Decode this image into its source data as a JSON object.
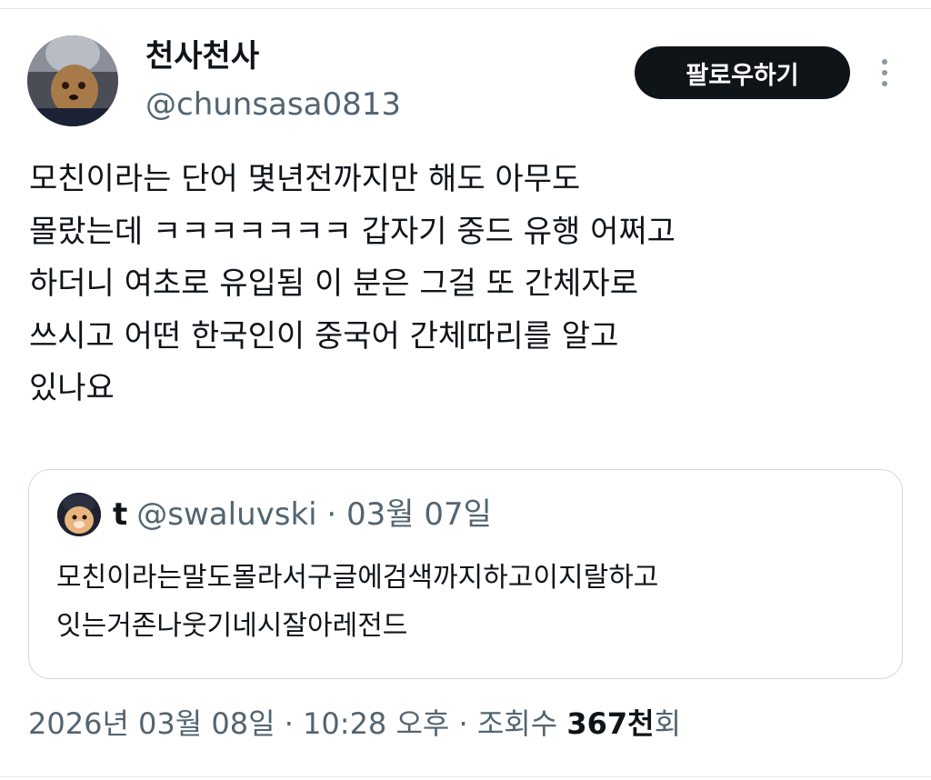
{
  "author": {
    "display_name": "천사천사",
    "handle": "@chunsasa0813"
  },
  "follow_button": {
    "label": "팔로우하기"
  },
  "more_icon": "vertical-ellipsis-icon",
  "tweet": {
    "lines": [
      "모친이라는 단어 몇년전까지만 해도 아무도",
      "몰랐는데 ㅋㅋㅋㅋㅋㅋㅋ 갑자기 중드 유행 어쩌고",
      "하더니 여초로 유입됨 이 분은 그걸 또 간체자로",
      "쓰시고 어떤 한국인이 중국어 간체따리를 알고",
      "있나요"
    ]
  },
  "quote": {
    "name": "t",
    "handle": "@swaluvski",
    "separator": "·",
    "date": "03월 07일",
    "lines": [
      "모친이라는말도몰라서구글에검색까지하고이지랄하고",
      "잇는거존나웃기네시잘아레전드"
    ]
  },
  "footer": {
    "date": "2026년 03월 08일",
    "separator": "·",
    "time": "10:28 오후",
    "views_label": "조회수",
    "views_count": "367천",
    "views_suffix": "회"
  },
  "colors": {
    "text_primary": "#0f1419",
    "text_secondary": "#536471",
    "border": "#cfd9de",
    "button_bg": "#0f1419",
    "button_text": "#ffffff"
  }
}
